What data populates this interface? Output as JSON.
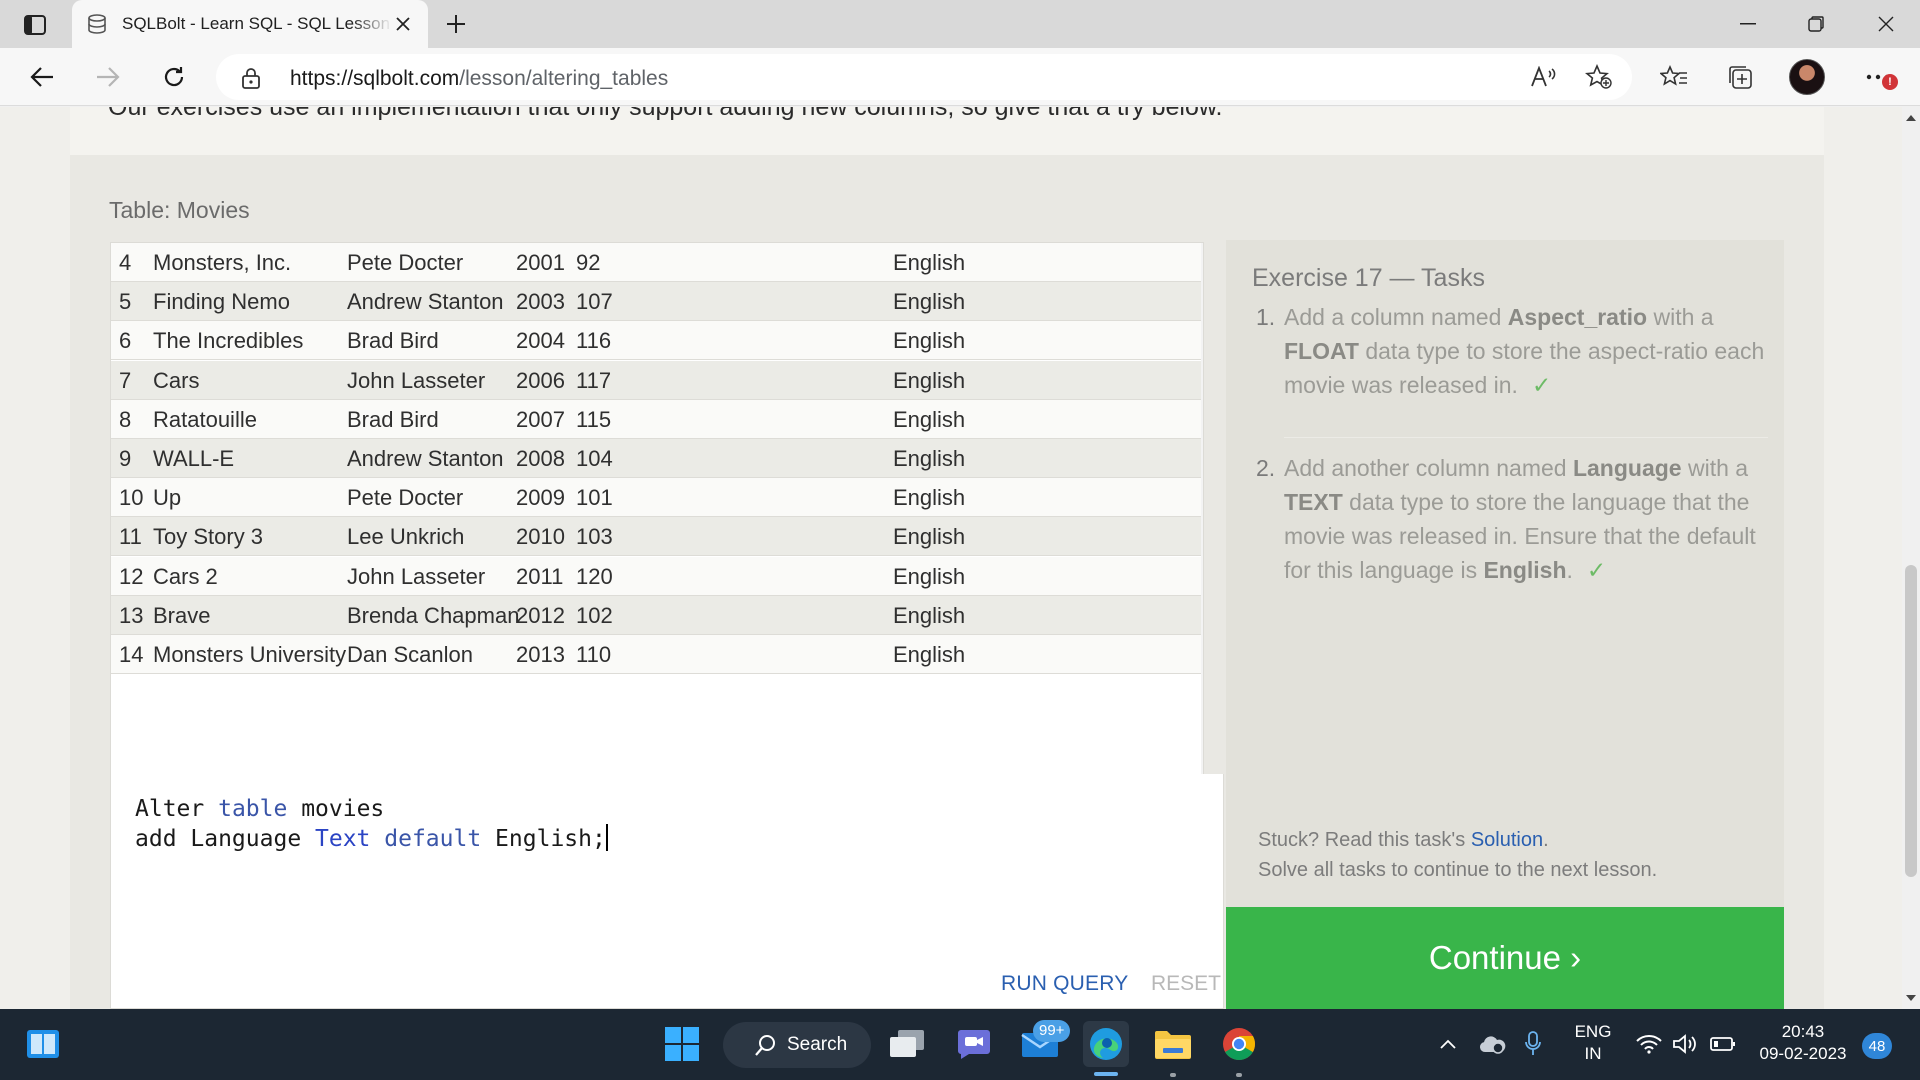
{
  "browser": {
    "tab_title": "SQLBolt - Learn SQL - SQL Lesson",
    "url_host": "https://sqlbolt.com",
    "url_path": "/lesson/altering_tables"
  },
  "page": {
    "intro_text": "Our exercises use an implementation that only support adding new columns, so give that a try below.",
    "table_caption": "Table: Movies",
    "rows": [
      {
        "id": "4",
        "title": "Monsters, Inc.",
        "director": "Pete Docter",
        "year": "2001",
        "length": "92",
        "language": "English"
      },
      {
        "id": "5",
        "title": "Finding Nemo",
        "director": "Andrew Stanton",
        "year": "2003",
        "length": "107",
        "language": "English"
      },
      {
        "id": "6",
        "title": "The Incredibles",
        "director": "Brad Bird",
        "year": "2004",
        "length": "116",
        "language": "English"
      },
      {
        "id": "7",
        "title": "Cars",
        "director": "John Lasseter",
        "year": "2006",
        "length": "117",
        "language": "English"
      },
      {
        "id": "8",
        "title": "Ratatouille",
        "director": "Brad Bird",
        "year": "2007",
        "length": "115",
        "language": "English"
      },
      {
        "id": "9",
        "title": "WALL-E",
        "director": "Andrew Stanton",
        "year": "2008",
        "length": "104",
        "language": "English"
      },
      {
        "id": "10",
        "title": "Up",
        "director": "Pete Docter",
        "year": "2009",
        "length": "101",
        "language": "English"
      },
      {
        "id": "11",
        "title": "Toy Story 3",
        "director": "Lee Unkrich",
        "year": "2010",
        "length": "103",
        "language": "English"
      },
      {
        "id": "12",
        "title": "Cars 2",
        "director": "John Lasseter",
        "year": "2011",
        "length": "120",
        "language": "English"
      },
      {
        "id": "13",
        "title": "Brave",
        "director": "Brenda Chapman",
        "year": "2012",
        "length": "102",
        "language": "English"
      },
      {
        "id": "14",
        "title": "Monsters University",
        "director": "Dan Scanlon",
        "year": "2013",
        "length": "110",
        "language": "English"
      }
    ],
    "editor": {
      "line1": {
        "a": "Alter ",
        "b": "table",
        "c": " movies"
      },
      "line2": {
        "a": "add Language ",
        "b": "Text",
        "c": " ",
        "d": "default",
        "e": " English;"
      }
    },
    "run_label": "RUN QUERY",
    "reset_label": "RESET",
    "tasks": {
      "title": "Exercise 17 — Tasks",
      "task1": {
        "num": "1.",
        "t1": "Add a column named ",
        "b1": "Aspect_ratio",
        "t2": " with a ",
        "b2": "FLOAT",
        "t3": " data type to store the aspect-ratio each movie was released in.",
        "check": "✓"
      },
      "task2": {
        "num": "2.",
        "t1": "Add another column named ",
        "b1": "Language",
        "t2": " with a ",
        "b2": "TEXT",
        "t3": " data type to store the language that the movie was released in. Ensure that the default for this language is ",
        "b3": "English",
        "t4": ".",
        "check": "✓"
      },
      "stuck_prefix": "Stuck? Read this task's ",
      "solution_link": "Solution",
      "stuck_suffix": ".",
      "solve_all": "Solve all tasks to continue to the next lesson.",
      "continue_label": "Continue ›"
    }
  },
  "taskbar": {
    "search_label": "Search",
    "mail_badge": "99+",
    "lang_line1": "ENG",
    "lang_line2": "IN",
    "time": "20:43",
    "date": "09-02-2023",
    "notification_count": "48"
  },
  "colors": {
    "continue": "#39b54a",
    "link": "#2a5fb0",
    "keyword": "#3a55a8",
    "check": "#6dbb66"
  }
}
